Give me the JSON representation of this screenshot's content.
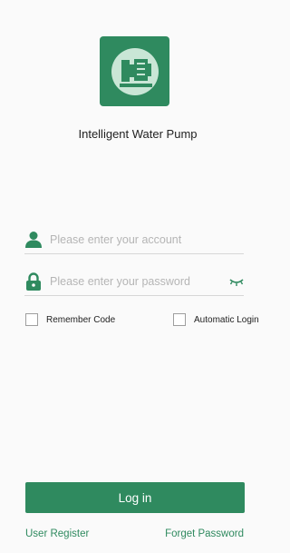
{
  "app": {
    "name": "Intelligent Water Pump",
    "logo_icon": "water-pump-icon"
  },
  "colors": {
    "accent": "#2f8a5f",
    "background": "#fafafa",
    "placeholder": "#b5b5b5"
  },
  "form": {
    "account": {
      "icon": "user-icon",
      "value": "",
      "placeholder": "Please enter your account"
    },
    "password": {
      "icon": "lock-icon",
      "value": "",
      "placeholder": "Please enter your password",
      "toggle_icon": "eye-closed-icon"
    },
    "remember": {
      "label": "Remember Code",
      "checked": false
    },
    "auto_login": {
      "label": "Automatic Login",
      "checked": false
    },
    "login_label": "Log in"
  },
  "footer": {
    "register_label": "User Register",
    "forgot_label": "Forget Password"
  }
}
